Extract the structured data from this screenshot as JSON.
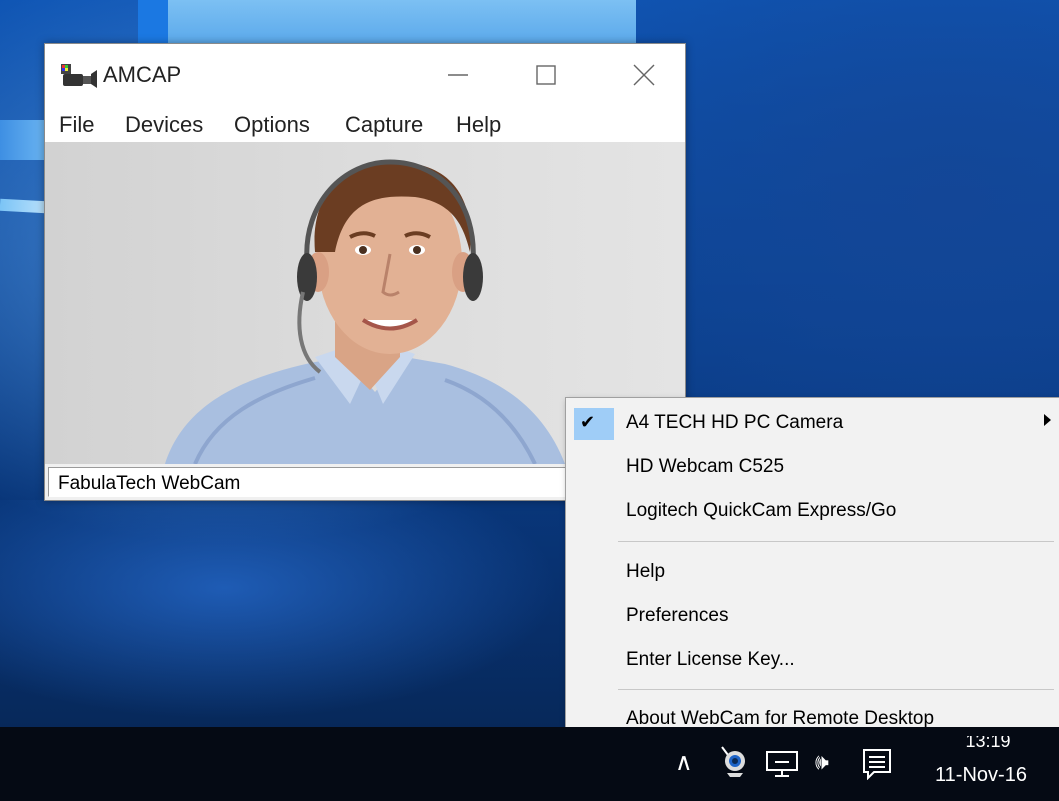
{
  "window": {
    "title": "AMCAP",
    "menu": [
      "File",
      "Devices",
      "Options",
      "Capture",
      "Help"
    ],
    "status_text": "FabulaTech WebCam"
  },
  "context_menu": {
    "items": [
      {
        "label": "A4 TECH HD PC Camera",
        "checked": true,
        "submenu": true
      },
      {
        "label": "HD Webcam C525"
      },
      {
        "label": "Logitech QuickCam Express/Go"
      },
      {
        "label": "Help"
      },
      {
        "label": "Preferences"
      },
      {
        "label": "Enter License Key..."
      },
      {
        "label": "About WebCam for Remote Desktop"
      }
    ],
    "check_glyph": "✔"
  },
  "taskbar": {
    "time": "13:19",
    "date": "11-Nov-16",
    "tray_icons": [
      "chevron-up-icon",
      "webcam-icon",
      "network-icon",
      "volume-icon",
      "action-center-icon"
    ],
    "chevron_glyph": "∧",
    "volume_glyph": "🕪"
  }
}
